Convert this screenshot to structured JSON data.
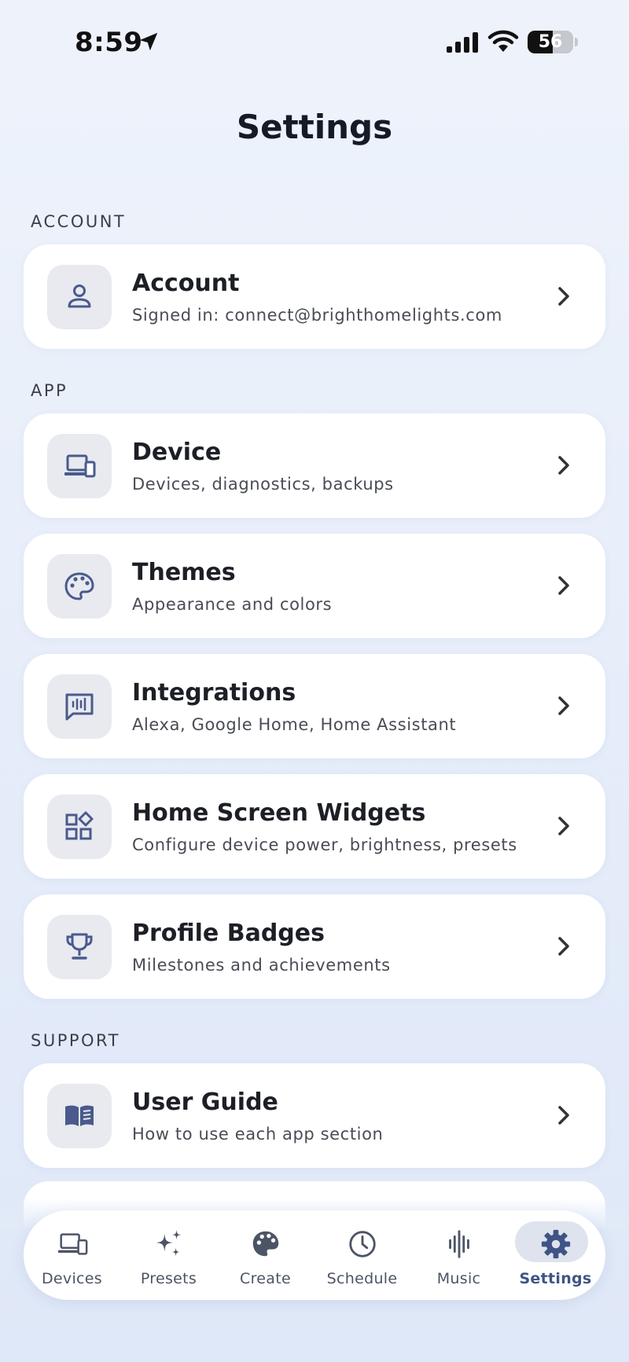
{
  "status_bar": {
    "time": "8:59",
    "battery": "56",
    "battery_level": 0.56
  },
  "page": {
    "title": "Settings"
  },
  "sections": {
    "account": "ACCOUNT",
    "app": "APP",
    "support": "SUPPORT"
  },
  "items": {
    "account": {
      "title": "Account",
      "subtitle": "Signed in: connect@brighthomelights.com",
      "icon": "person-icon"
    },
    "device": {
      "title": "Device",
      "subtitle": "Devices, diagnostics, backups",
      "icon": "devices-icon"
    },
    "themes": {
      "title": "Themes",
      "subtitle": "Appearance and colors",
      "icon": "palette-icon"
    },
    "integrations": {
      "title": "Integrations",
      "subtitle": "Alexa, Google Home, Home Assistant",
      "icon": "voice-chat-icon"
    },
    "widgets": {
      "title": "Home Screen Widgets",
      "subtitle": "Configure device power, brightness, presets",
      "icon": "widgets-icon"
    },
    "badges": {
      "title": "Profile Badges",
      "subtitle": "Milestones and achievements",
      "icon": "trophy-icon"
    },
    "guide": {
      "title": "User Guide",
      "subtitle": "How to use each app section",
      "icon": "book-icon"
    }
  },
  "tabs": [
    {
      "label": "Devices",
      "icon": "devices-icon"
    },
    {
      "label": "Presets",
      "icon": "sparkles-icon"
    },
    {
      "label": "Create",
      "icon": "palette-icon"
    },
    {
      "label": "Schedule",
      "icon": "clock-icon"
    },
    {
      "label": "Music",
      "icon": "waveform-icon"
    },
    {
      "label": "Settings",
      "icon": "gear-icon",
      "active": true
    }
  ],
  "colors": {
    "accent": "#4a5a8c",
    "icon_box": "#e8eaf0",
    "active_tab_pill": "#dfe3ee"
  }
}
